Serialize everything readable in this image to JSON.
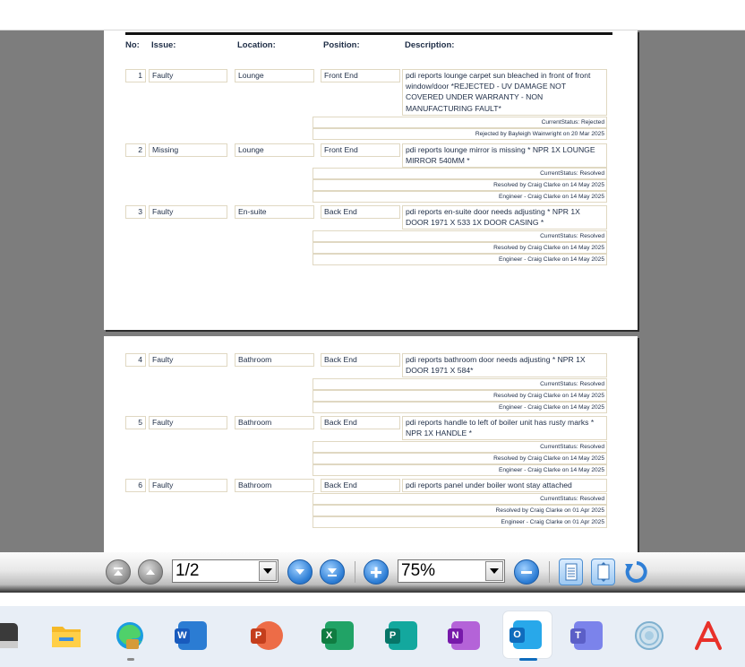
{
  "headers": {
    "no": "No:",
    "issue": "Issue:",
    "location": "Location:",
    "position": "Position:",
    "description": "Description:"
  },
  "rows": [
    {
      "no": "1",
      "issue": "Faulty",
      "location": "Lounge",
      "position": "Front End",
      "description": "pdi reports lounge carpet sun bleached in front of front window/door  *REJECTED - UV DAMAGE NOT COVERED UNDER WARRANTY - NON MANUFACTURING FAULT*",
      "status_lines": [
        "CurrentStatus: Rejected",
        "Rejected by Bayleigh Wainwright on 20 Mar 2025"
      ]
    },
    {
      "no": "2",
      "issue": "Missing",
      "location": "Lounge",
      "position": "Front End",
      "description": "pdi reports lounge mirror is missing * NPR 1X LOUNGE MIRROR 540MM *",
      "status_lines": [
        "CurrentStatus: Resolved",
        "Resolved by Craig Clarke on 14 May 2025",
        "Engineer - Craig Clarke on 14 May 2025"
      ]
    },
    {
      "no": "3",
      "issue": "Faulty",
      "location": "En-suite",
      "position": "Back End",
      "description": "pdi reports en-suite door needs adjusting * NPR 1X DOOR 1971 X 533 1X DOOR CASING *",
      "status_lines": [
        "CurrentStatus: Resolved",
        "Resolved by Craig Clarke on 14 May 2025",
        "Engineer - Craig Clarke on 14 May 2025"
      ]
    },
    {
      "no": "4",
      "issue": "Faulty",
      "location": "Bathroom",
      "position": "Back End",
      "description": "pdi reports bathroom door needs adjusting * NPR 1X DOOR 1971 X 584*",
      "status_lines": [
        "CurrentStatus: Resolved",
        "Resolved by Craig Clarke on 14 May 2025",
        "Engineer - Craig Clarke on 14 May 2025"
      ]
    },
    {
      "no": "5",
      "issue": "Faulty",
      "location": "Bathroom",
      "position": "Back End",
      "description": "pdi reports handle to left of boiler unit has rusty marks * NPR 1X HANDLE *",
      "status_lines": [
        "CurrentStatus: Resolved",
        "Resolved by Craig Clarke on 14 May 2025",
        "Engineer - Craig Clarke on 14 May 2025"
      ]
    },
    {
      "no": "6",
      "issue": "Faulty",
      "location": "Bathroom",
      "position": "Back End",
      "description": "pdi reports panel under boiler wont stay attached",
      "status_lines": [
        "CurrentStatus: Resolved",
        "Resolved by Craig Clarke on 01 Apr 2025",
        "Engineer - Craig Clarke on 01 Apr 2025"
      ]
    }
  ],
  "toolbar": {
    "page_field": "1/2",
    "zoom_field": "75%",
    "icons": [
      "first-page-icon",
      "previous-page-icon",
      "next-page-icon",
      "last-page-icon",
      "zoom-in-icon",
      "zoom-out-icon",
      "fit-width-icon",
      "fit-page-icon",
      "refresh-icon"
    ]
  },
  "taskbar": {
    "apps": [
      "file-explorer-icon",
      "edge-icon",
      "word-icon",
      "powerpoint-icon",
      "excel-icon",
      "publisher-icon",
      "onenote-icon",
      "outlook-icon",
      "teams-icon",
      "app-icon",
      "acrobat-icon"
    ],
    "letters": {
      "word": "W",
      "powerpoint": "P",
      "excel": "X",
      "publisher": "P",
      "onenote": "N",
      "outlook": "O",
      "teams": "T"
    },
    "active_app": "outlook-icon",
    "colors": {
      "word": "#185abd",
      "powerpoint": "#c43e1c",
      "excel": "#107c41",
      "publisher": "#077568",
      "onenote": "#7719aa",
      "outlook": "#0f6cbd",
      "teams": "#5b5fc7",
      "acrobat": "#e8312a"
    }
  }
}
